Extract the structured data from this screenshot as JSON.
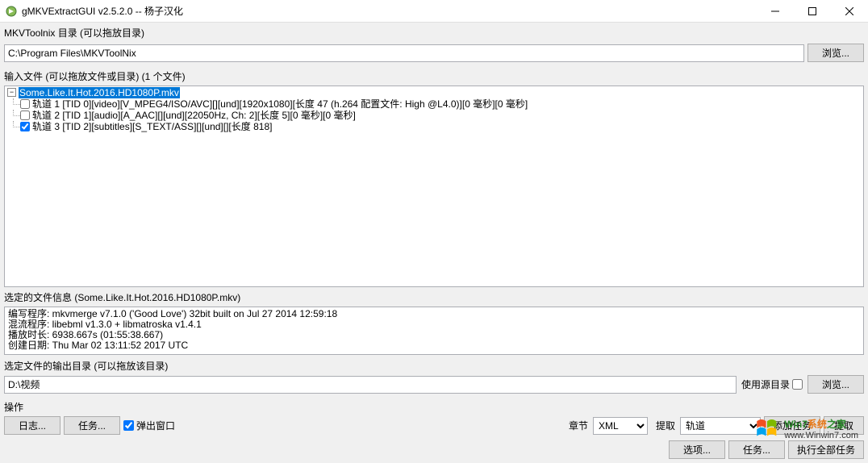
{
  "window": {
    "title": "gMKVExtractGUI v2.5.2.0 -- 杨子汉化"
  },
  "mkvtoolnix": {
    "label": "MKVToolnix 目录 (可以拖放目录)",
    "path": "C:\\Program Files\\MKVToolNix",
    "browse": "浏览..."
  },
  "input": {
    "label": "输入文件 (可以拖放文件或目录) (1 个文件)"
  },
  "tree": {
    "root": "Some.Like.It.Hot.2016.HD1080P.mkv",
    "tracks": [
      {
        "checked": false,
        "text": "轨道 1 [TID 0][video][V_MPEG4/ISO/AVC][][und][1920x1080][长度 47 (h.264 配置文件: High @L4.0)][0 毫秒][0 毫秒]"
      },
      {
        "checked": false,
        "text": "轨道 2 [TID 1][audio][A_AAC][][und][22050Hz, Ch: 2][长度 5][0 毫秒][0 毫秒]"
      },
      {
        "checked": true,
        "text": "轨道 3 [TID 2][subtitles][S_TEXT/ASS][][und][][长度 818]"
      }
    ]
  },
  "fileinfo": {
    "title": "选定的文件信息 (Some.Like.It.Hot.2016.HD1080P.mkv)",
    "l1": "编写程序: mkvmerge v7.1.0 ('Good Love') 32bit built on Jul 27 2014 12:59:18",
    "l2": "混流程序: libebml v1.3.0 + libmatroska v1.4.1",
    "l3": "播放时长: 6938.667s (01:55:38.667)",
    "l4": "创建日期: Thu Mar 02 13:11:52 2017 UTC"
  },
  "outdir": {
    "label": "选定文件的输出目录 (可以拖放该目录)",
    "path": "D:\\视频",
    "use_src": "使用源目录",
    "use_src_checked": false,
    "browse": "浏览..."
  },
  "ops": {
    "label": "操作",
    "log": "日志...",
    "jobs": "任务...",
    "popup": "弹出窗口",
    "popup_checked": true,
    "chapter": "章节",
    "chapter_sel": "XML",
    "extract": "提取",
    "extract_sel": "轨道",
    "add_job": "添加任务",
    "do_extract": "提取"
  },
  "bottom": {
    "options": "选项...",
    "jobs2": "任务...",
    "exec": "执行全部任务"
  },
  "watermark": {
    "brand_a": "Win7",
    "brand_b": "系统",
    "brand_c": "之家",
    "url": "www.Winwin7.com"
  }
}
